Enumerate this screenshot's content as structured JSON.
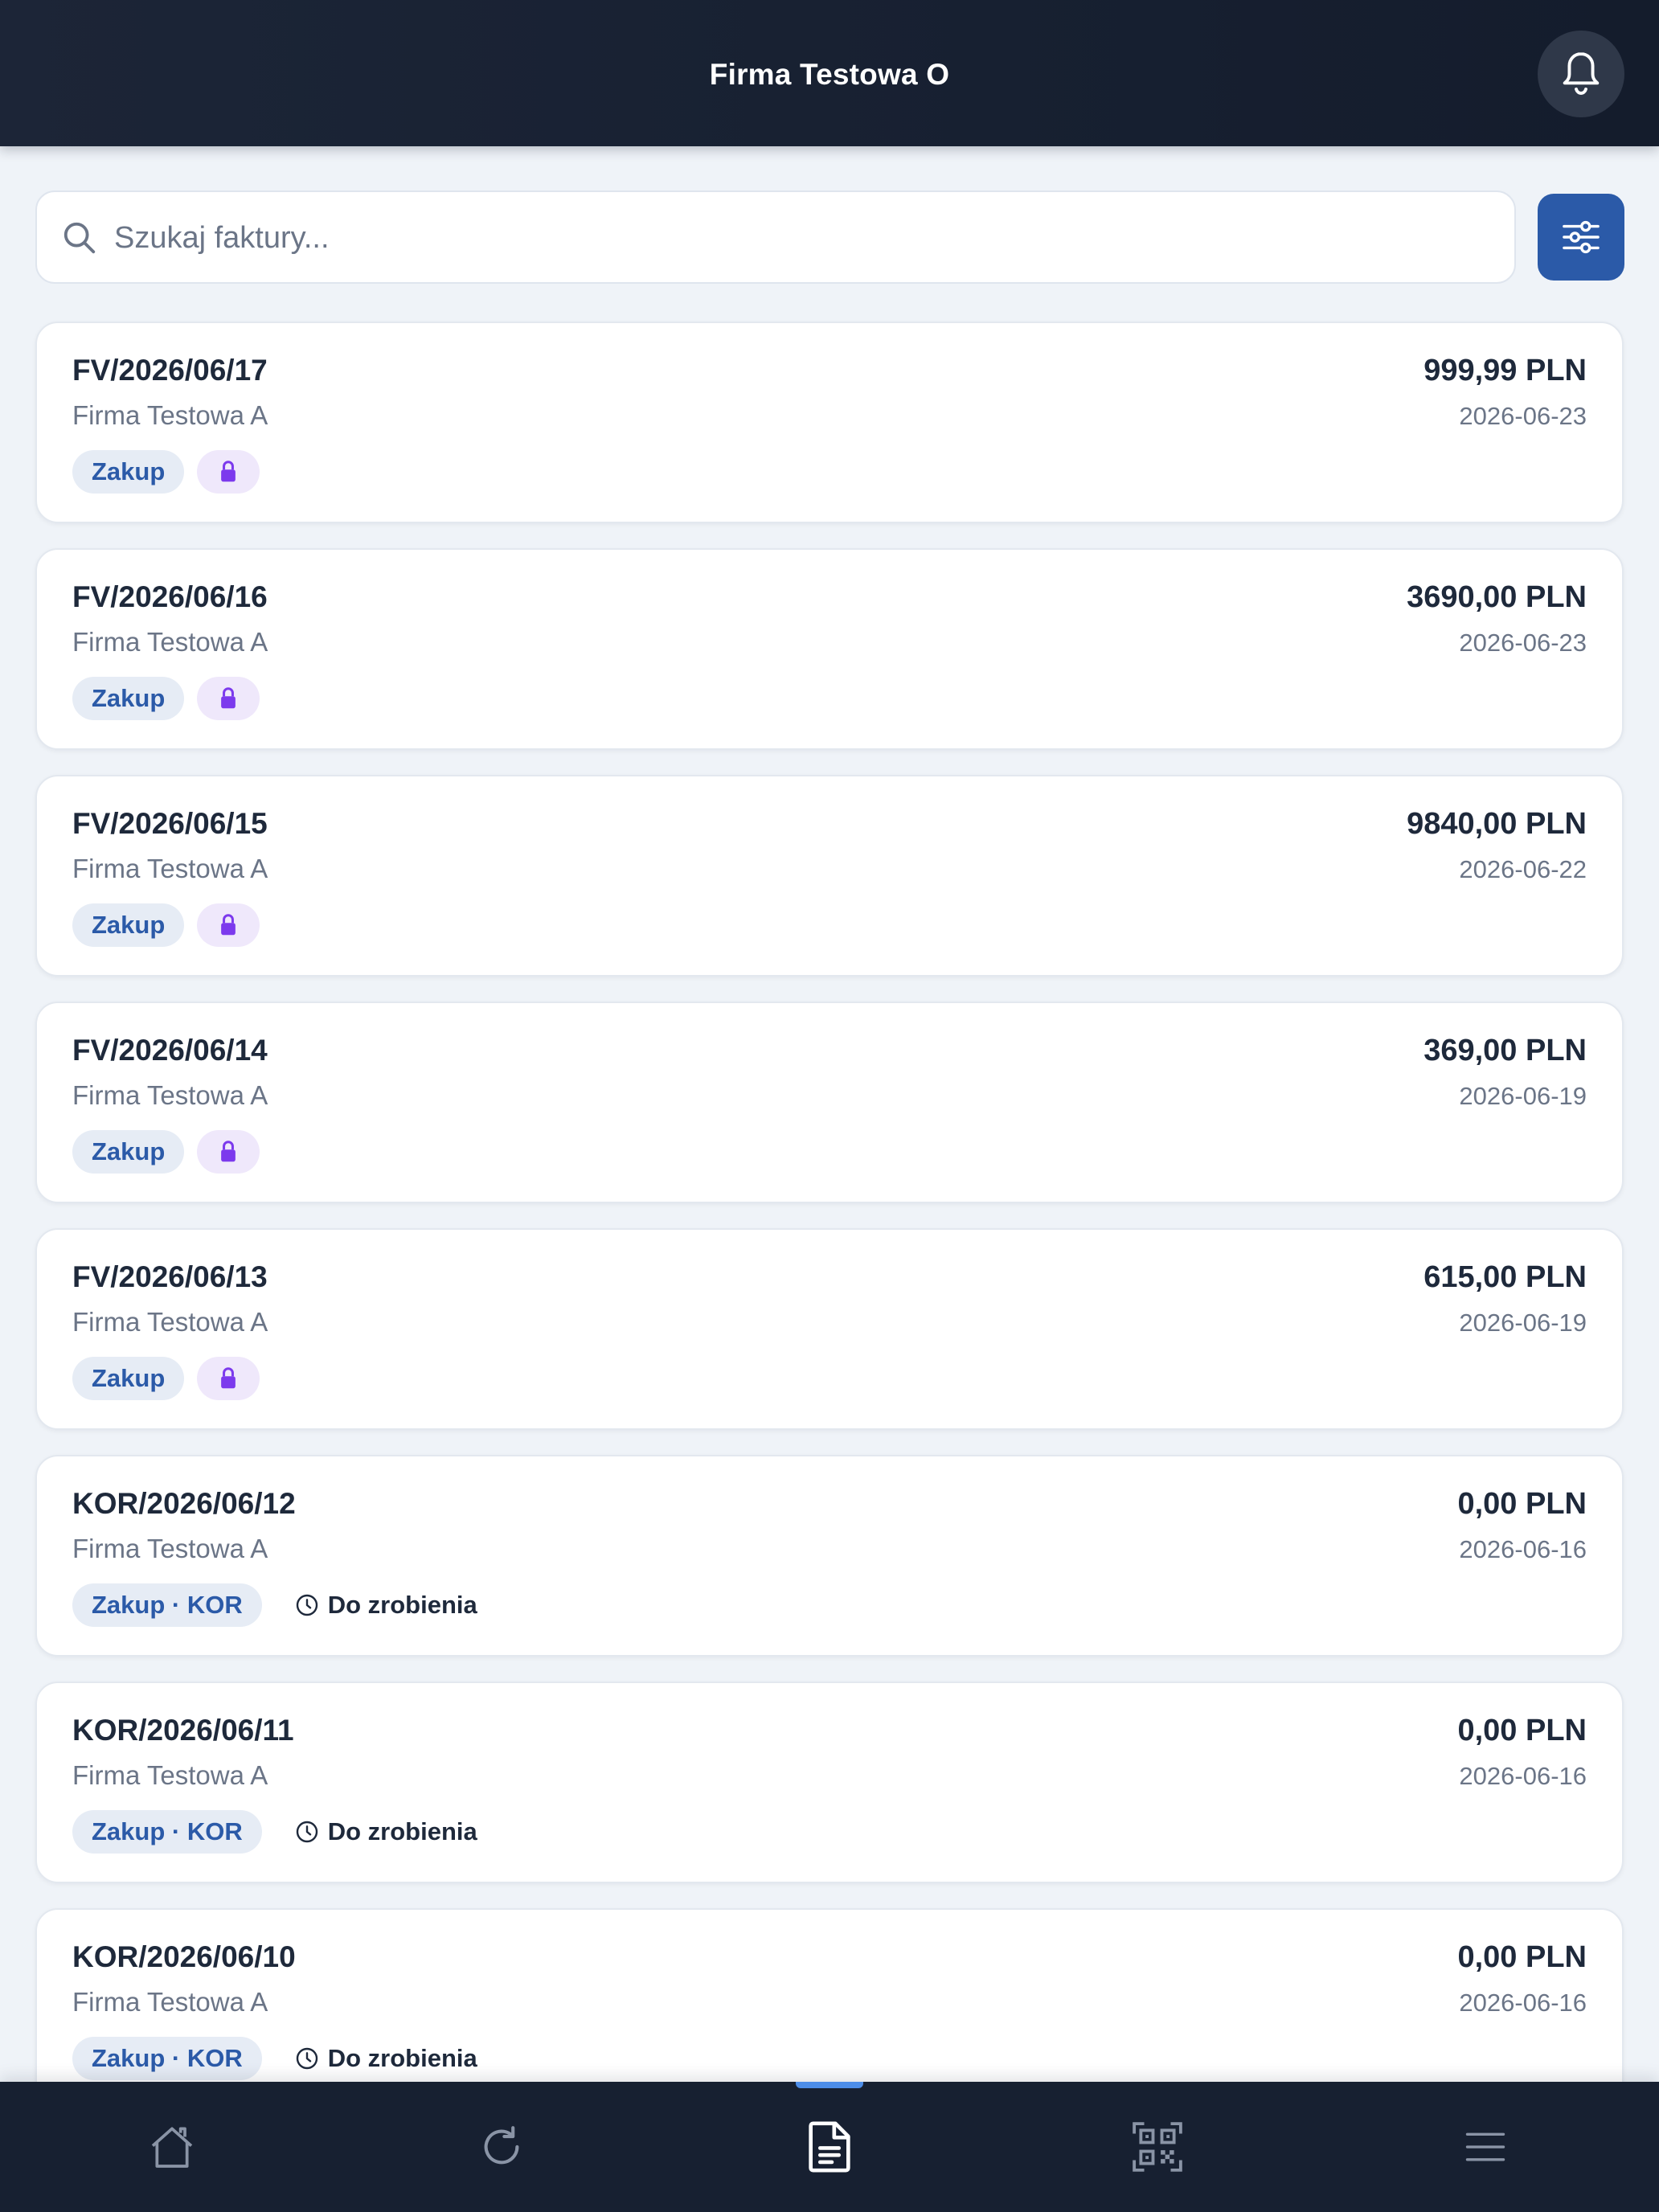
{
  "header": {
    "title": "Firma Testowa O",
    "notifications_icon": "bell-icon"
  },
  "search": {
    "placeholder": "Szukaj faktury...",
    "value": "",
    "icon": "search-icon",
    "filter_icon": "sliders-icon"
  },
  "invoices": [
    {
      "number": "FV/2026/06/17",
      "company": "Firma Testowa A",
      "amount": "999,99 PLN",
      "date": "2026-06-23",
      "tag": "Zakup",
      "locked": true,
      "status": ""
    },
    {
      "number": "FV/2026/06/16",
      "company": "Firma Testowa A",
      "amount": "3690,00 PLN",
      "date": "2026-06-23",
      "tag": "Zakup",
      "locked": true,
      "status": ""
    },
    {
      "number": "FV/2026/06/15",
      "company": "Firma Testowa A",
      "amount": "9840,00 PLN",
      "date": "2026-06-22",
      "tag": "Zakup",
      "locked": true,
      "status": ""
    },
    {
      "number": "FV/2026/06/14",
      "company": "Firma Testowa A",
      "amount": "369,00 PLN",
      "date": "2026-06-19",
      "tag": "Zakup",
      "locked": true,
      "status": ""
    },
    {
      "number": "FV/2026/06/13",
      "company": "Firma Testowa A",
      "amount": "615,00 PLN",
      "date": "2026-06-19",
      "tag": "Zakup",
      "locked": true,
      "status": ""
    },
    {
      "number": "KOR/2026/06/12",
      "company": "Firma Testowa A",
      "amount": "0,00 PLN",
      "date": "2026-06-16",
      "tag": "Zakup · KOR",
      "locked": false,
      "status": "Do zrobienia"
    },
    {
      "number": "KOR/2026/06/11",
      "company": "Firma Testowa A",
      "amount": "0,00 PLN",
      "date": "2026-06-16",
      "tag": "Zakup · KOR",
      "locked": false,
      "status": "Do zrobienia"
    },
    {
      "number": "KOR/2026/06/10",
      "company": "Firma Testowa A",
      "amount": "0,00 PLN",
      "date": "2026-06-16",
      "tag": "Zakup · KOR",
      "locked": false,
      "status": "Do zrobienia"
    }
  ],
  "bottom_nav": {
    "items": [
      {
        "icon": "home-icon",
        "active": false
      },
      {
        "icon": "refresh-icon",
        "active": false
      },
      {
        "icon": "document-icon",
        "active": true
      },
      {
        "icon": "qr-code-icon",
        "active": false
      },
      {
        "icon": "menu-icon",
        "active": false
      }
    ],
    "active_color": "#4d8de8"
  },
  "colors": {
    "header_bg": "#1a2334",
    "accent": "#2b5aa8",
    "lock_badge_bg": "#efe8fb",
    "lock_icon": "#7c3aed",
    "muted_text": "#6b7587"
  }
}
